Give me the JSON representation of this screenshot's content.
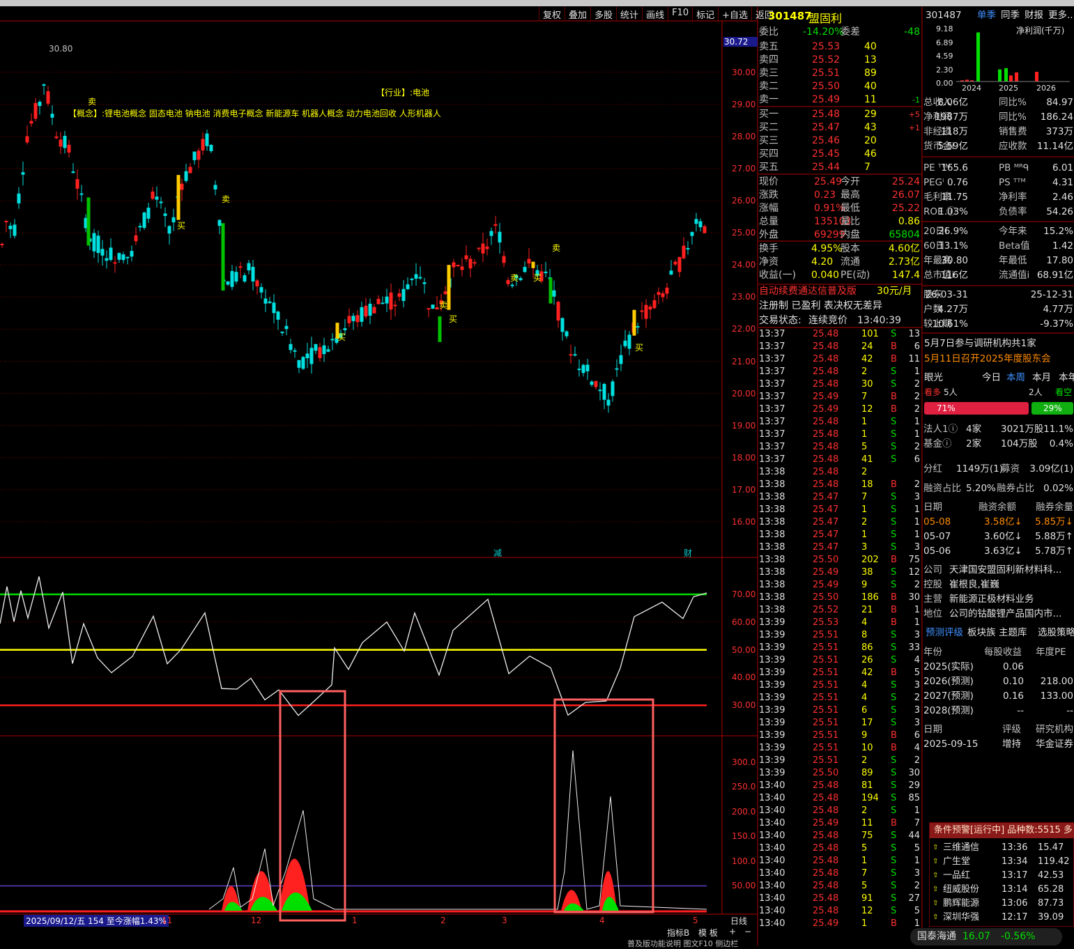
{
  "toolbar": [
    "复权",
    "叠加",
    "多股",
    "统计",
    "画线",
    "F10",
    "标记",
    "+自选",
    "返回"
  ],
  "chart": {
    "price_axis": [
      "30.00",
      "29.00",
      "28.00",
      "27.00",
      "26.00",
      "25.00",
      "24.00",
      "23.00",
      "22.00",
      "21.00",
      "20.00",
      "19.00",
      "18.00",
      "17.00",
      "16.00"
    ],
    "price_current": "30.72",
    "peak_label": "30.80",
    "industry_text": "【行业】:电池",
    "concept_text": "【概念】:锂电池概念 固态电池 钠电池 消费电子概念 新能源车 机器人概念 动力电池回收 人形机器人",
    "events": [
      "减",
      "财"
    ],
    "rsi_axis": [
      "70.00",
      "60.00",
      "50.00",
      "40.00",
      "30.00"
    ],
    "vol_axis": [
      "300.0",
      "250.0",
      "200.0",
      "150.0",
      "100.0",
      "50.00"
    ],
    "date_info": "2025/09/12/五 154 至今涨幅1.43%",
    "x_labels": [
      "11",
      "12",
      "1",
      "2",
      "3",
      "4",
      "5"
    ],
    "period": "日线",
    "bottom_buttons": [
      "指标B",
      "模 板",
      "+",
      "−"
    ],
    "bottom_tabs": "普及版功能说明 图文F10 侧边栏"
  },
  "quote": {
    "code": "301487",
    "name": "盟固利",
    "weibi_label": "委比",
    "weibi": "-14.20%",
    "weicha_label": "委差",
    "weicha": "-48",
    "sells": [
      {
        "label": "卖五",
        "price": "25.53",
        "vol": "40",
        "chg": ""
      },
      {
        "label": "卖四",
        "price": "25.52",
        "vol": "13",
        "chg": ""
      },
      {
        "label": "卖三",
        "price": "25.51",
        "vol": "89",
        "chg": ""
      },
      {
        "label": "卖二",
        "price": "25.50",
        "vol": "40",
        "chg": ""
      },
      {
        "label": "卖一",
        "price": "25.49",
        "vol": "11",
        "chg": "-1"
      }
    ],
    "buys": [
      {
        "label": "买一",
        "price": "25.48",
        "vol": "29",
        "chg": "+5"
      },
      {
        "label": "买二",
        "price": "25.47",
        "vol": "43",
        "chg": "+1"
      },
      {
        "label": "买三",
        "price": "25.46",
        "vol": "20",
        "chg": ""
      },
      {
        "label": "买四",
        "price": "25.45",
        "vol": "46",
        "chg": ""
      },
      {
        "label": "买五",
        "price": "25.44",
        "vol": "7",
        "chg": ""
      }
    ],
    "stats": [
      [
        "现价",
        "25.49",
        "今开",
        "25.24"
      ],
      [
        "涨跌",
        "0.23",
        "最高",
        "26.07"
      ],
      [
        "涨幅",
        "0.91%",
        "最低",
        "25.22"
      ],
      [
        "总量",
        "135103",
        "量比",
        "0.86"
      ],
      [
        "外盘",
        "69299",
        "内盘",
        "65804"
      ]
    ],
    "stats2": [
      [
        "换手",
        "4.95%",
        "股本",
        "4.60亿"
      ],
      [
        "净资",
        "4.20",
        "流通",
        "2.73亿"
      ],
      [
        "收益(一)",
        "0.040",
        "PE(动)",
        "147.4"
      ]
    ],
    "promo": "自动续费通达信普及版",
    "promo_price": "30元/月",
    "reg": "注册制 已盈利 表决权无差异",
    "status_label": "交易状态:",
    "status": "连续竞价",
    "status_time": "13:40:39"
  },
  "ticks": [
    [
      "13:37",
      "25.48",
      "101",
      "S",
      "13"
    ],
    [
      "13:37",
      "25.48",
      "24",
      "B",
      "6"
    ],
    [
      "13:37",
      "25.48",
      "42",
      "B",
      "11"
    ],
    [
      "13:37",
      "25.48",
      "2",
      "S",
      "1"
    ],
    [
      "13:37",
      "25.48",
      "30",
      "S",
      "2"
    ],
    [
      "13:37",
      "25.49",
      "7",
      "B",
      "2"
    ],
    [
      "13:37",
      "25.49",
      "12",
      "B",
      "2"
    ],
    [
      "13:37",
      "25.48",
      "1",
      "S",
      "1"
    ],
    [
      "13:37",
      "25.48",
      "1",
      "S",
      "1"
    ],
    [
      "13:37",
      "25.48",
      "5",
      "S",
      "2"
    ],
    [
      "13:37",
      "25.48",
      "41",
      "S",
      "6"
    ],
    [
      "13:38",
      "25.48",
      "2",
      "",
      ""
    ],
    [
      "13:38",
      "25.48",
      "18",
      "B",
      "2"
    ],
    [
      "13:38",
      "25.47",
      "7",
      "S",
      "3"
    ],
    [
      "13:38",
      "25.47",
      "1",
      "S",
      "1"
    ],
    [
      "13:38",
      "25.47",
      "2",
      "S",
      "1"
    ],
    [
      "13:38",
      "25.47",
      "1",
      "S",
      "1"
    ],
    [
      "13:38",
      "25.47",
      "3",
      "S",
      "3"
    ],
    [
      "13:38",
      "25.50",
      "202",
      "B",
      "75"
    ],
    [
      "13:38",
      "25.49",
      "38",
      "S",
      "12"
    ],
    [
      "13:38",
      "25.49",
      "9",
      "S",
      "2"
    ],
    [
      "13:38",
      "25.50",
      "186",
      "B",
      "30"
    ],
    [
      "13:38",
      "25.52",
      "21",
      "B",
      "1"
    ],
    [
      "13:39",
      "25.53",
      "4",
      "B",
      "1"
    ],
    [
      "13:39",
      "25.51",
      "8",
      "S",
      "3"
    ],
    [
      "13:39",
      "25.51",
      "86",
      "S",
      "33"
    ],
    [
      "13:39",
      "25.51",
      "26",
      "S",
      "4"
    ],
    [
      "13:39",
      "25.51",
      "42",
      "B",
      "5"
    ],
    [
      "13:39",
      "25.51",
      "4",
      "S",
      "3"
    ],
    [
      "13:39",
      "25.51",
      "4",
      "S",
      "2"
    ],
    [
      "13:39",
      "25.51",
      "6",
      "S",
      "3"
    ],
    [
      "13:39",
      "25.51",
      "17",
      "S",
      "3"
    ],
    [
      "13:39",
      "25.51",
      "9",
      "B",
      "6"
    ],
    [
      "13:39",
      "25.51",
      "10",
      "B",
      "4"
    ],
    [
      "13:39",
      "25.51",
      "2",
      "S",
      "2"
    ],
    [
      "13:39",
      "25.50",
      "89",
      "S",
      "30"
    ],
    [
      "13:40",
      "25.48",
      "81",
      "S",
      "29"
    ],
    [
      "13:40",
      "25.48",
      "194",
      "S",
      "85"
    ],
    [
      "13:40",
      "25.48",
      "2",
      "S",
      "1"
    ],
    [
      "13:40",
      "25.49",
      "11",
      "B",
      "7"
    ],
    [
      "13:40",
      "25.48",
      "75",
      "S",
      "44"
    ],
    [
      "13:40",
      "25.48",
      "5",
      "S",
      "5"
    ],
    [
      "13:40",
      "25.48",
      "1",
      "S",
      "1"
    ],
    [
      "13:40",
      "25.48",
      "7",
      "S",
      "3"
    ],
    [
      "13:40",
      "25.48",
      "5",
      "S",
      "2"
    ],
    [
      "13:40",
      "25.48",
      "91",
      "S",
      "27"
    ],
    [
      "13:40",
      "25.48",
      "12",
      "S",
      "5"
    ],
    [
      "13:40",
      "25.49",
      "1",
      "B",
      "1"
    ]
  ],
  "fin": {
    "header": [
      "301487",
      "单季",
      "同季",
      "财报",
      "更多.."
    ],
    "chart_title": "净利润(千万)",
    "chart_y": [
      "9.18",
      "6.89",
      "4.59",
      "2.30",
      "0.00"
    ],
    "chart_x": [
      "2024",
      "2025",
      "2026"
    ],
    "rows1": [
      [
        "总收入",
        "8.06亿",
        "同比%",
        "84.97"
      ],
      [
        "净利润",
        "1987万",
        "同比%",
        "186.24"
      ],
      [
        "非经损",
        "118万",
        "销售费",
        "373万"
      ],
      [
        "货币金i",
        "5.59亿",
        "应收款",
        "11.14亿"
      ]
    ],
    "rows2": [
      [
        "PE ᵀᵀᴹ",
        "165.6",
        "PB ᴹᴿᑫ",
        "6.01"
      ],
      [
        "PEGⁱ",
        "0.76",
        "PS ᵀᵀᴹ",
        "4.31"
      ],
      [
        "毛利率",
        "11.75",
        "净利率",
        "2.46"
      ],
      [
        "ROE ⓘ",
        "1.03%",
        "负债率",
        "54.26"
      ]
    ],
    "rows3": [
      [
        "20日i",
        "26.9%",
        "今年来",
        "15.2%"
      ],
      [
        "60日",
        "13.1%",
        "Beta值",
        "1.42"
      ],
      [
        "年最高",
        "30.80",
        "年最低",
        "17.80"
      ],
      [
        "总市值i",
        "116亿",
        "流通值i",
        "68.91亿"
      ]
    ],
    "rows4": [
      [
        "股东",
        "26-03-31",
        "",
        "25-12-31"
      ],
      [
        "户数",
        "4.27万",
        "",
        "4.77万"
      ],
      [
        "较上期",
        "-10.61%",
        "",
        "-9.37%"
      ]
    ],
    "news1": "5月7日参与调研机构共1家",
    "news2": "5月11日召开2025年度股东会",
    "yg": [
      "眼光",
      "今日",
      "本周",
      "本月",
      "本年"
    ],
    "bull": "看多",
    "bull_n": "5人",
    "bear_n": "2人",
    "bear": "看空",
    "bull_pct": "71%",
    "bear_pct": "29%",
    "inst": [
      [
        "法人1ⓘ",
        "4家",
        "3021万股",
        "11.1%"
      ],
      [
        "基金ⓘ",
        "2家",
        "104万股",
        "0.4%"
      ]
    ],
    "div": [
      "分红",
      "1149万(1)",
      "募资",
      "3.09亿(1)"
    ],
    "margin": [
      "融资占比",
      "5.20%",
      "融券占比",
      "0.02%"
    ],
    "mh": [
      "日期",
      "融资余额",
      "融券余量"
    ],
    "mr": [
      [
        "05-08",
        "3.58亿↓",
        "5.85万↓"
      ],
      [
        "05-07",
        "3.60亿↓",
        "5.88万↑"
      ],
      [
        "05-06",
        "3.63亿↓",
        "5.78万↑"
      ]
    ],
    "info": [
      [
        "公司",
        "天津国安盟固利新材料科..."
      ],
      [
        "控股",
        "崔根良,崔巍"
      ],
      [
        "主营",
        "新能源正极材料业务"
      ],
      [
        "地位",
        "公司的钴酸锂产品国内市..."
      ]
    ],
    "tabs": [
      "预测评级",
      "板块族",
      "主题库",
      "选股策略"
    ],
    "fh": [
      "年份",
      "每股收益",
      "年度PE"
    ],
    "fr": [
      [
        "2025(实际)",
        "0.06",
        ""
      ],
      [
        "2026(预测)",
        "0.10",
        "218.00"
      ],
      [
        "2027(预测)",
        "0.16",
        "133.00"
      ],
      [
        "2028(预测)",
        "--",
        "--"
      ]
    ],
    "rh": [
      "日期",
      "评级",
      "研究机构"
    ],
    "rr": [
      [
        "2025-09-15",
        "增持",
        "华金证券"
      ]
    ]
  },
  "watch": {
    "title": "条件预警[运行中] 品种数:5515 多",
    "rows": [
      [
        "三维通信",
        "13:36",
        "15.47"
      ],
      [
        "广生堂",
        "13:34",
        "119.42"
      ],
      [
        "一品红",
        "13:17",
        "42.53"
      ],
      [
        "纽威股份",
        "13:14",
        "65.28"
      ],
      [
        "鹏辉能源",
        "13:06",
        "87.73"
      ],
      [
        "深圳华强",
        "12:17",
        "39.09"
      ]
    ],
    "ticker": [
      "国泰海通",
      "16.07",
      "-0.56%"
    ]
  }
}
